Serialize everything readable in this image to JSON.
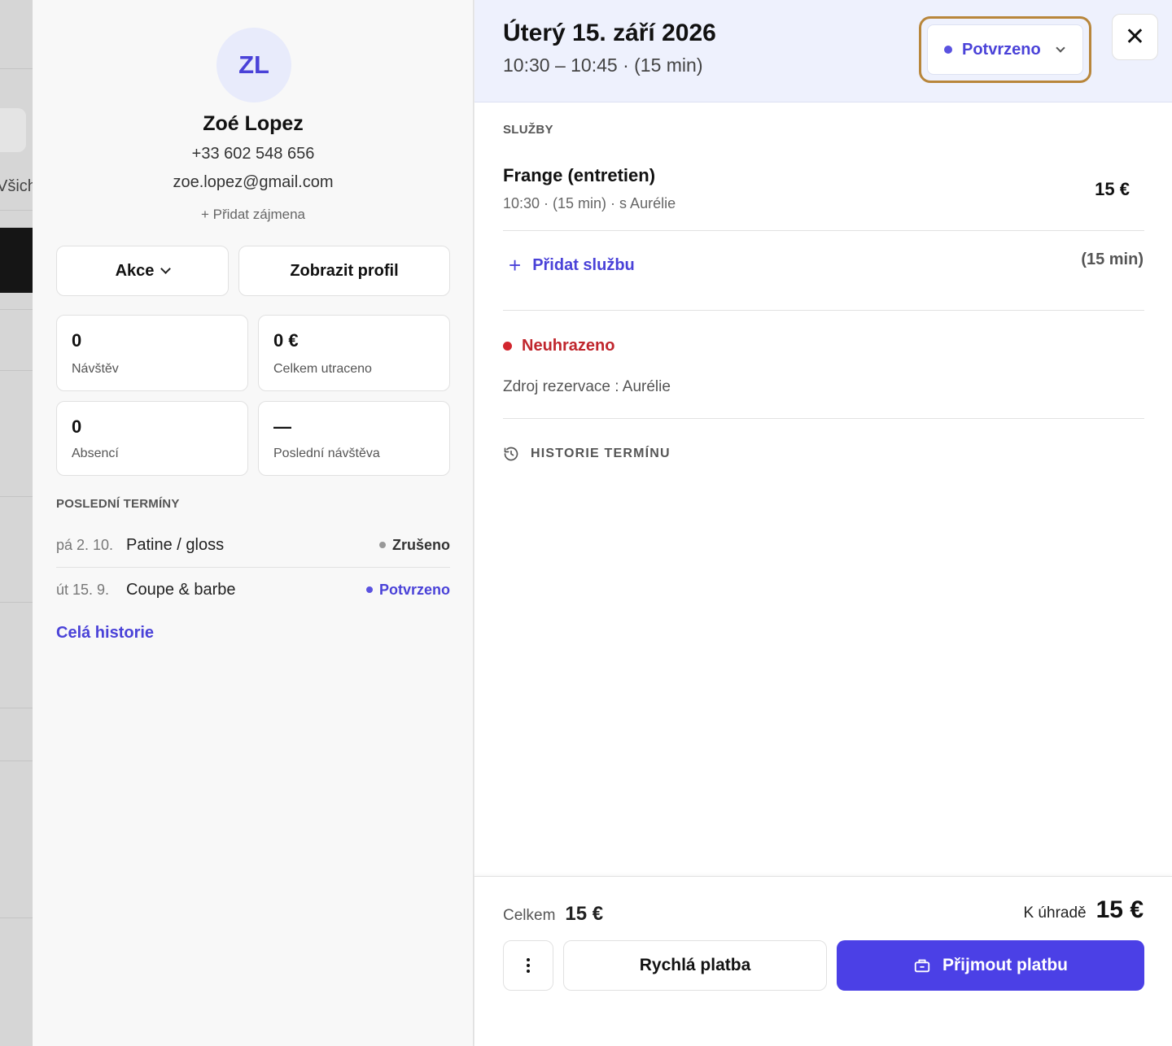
{
  "background": {
    "partial_text": "Všich"
  },
  "client": {
    "initials": "ZL",
    "name": "Zoé Lopez",
    "phone": "+33 602 548 656",
    "email": "zoe.lopez@gmail.com",
    "add_pronouns": "+ Přidat zájmena",
    "actions_label": "Akce",
    "view_profile_label": "Zobrazit profil",
    "stats": [
      {
        "value": "0",
        "label": "Návštěv"
      },
      {
        "value": "0 €",
        "label": "Celkem utraceno"
      },
      {
        "value": "0",
        "label": "Absencí"
      },
      {
        "value": "—",
        "label": "Poslední návštěva"
      }
    ],
    "recent_title": "POSLEDNÍ TERMÍNY",
    "recent": [
      {
        "date": "pá 2. 10.",
        "service": "Patine / gloss",
        "status": "Zrušeno",
        "status_color": "#333333",
        "dot_color": "#999999"
      },
      {
        "date": "út 15. 9.",
        "service": "Coupe & barbe",
        "status": "Potvrzeno",
        "status_color": "#4a42d8",
        "dot_color": "#5a52e0"
      }
    ],
    "history_link": "Celá historie"
  },
  "appointment": {
    "date": "Úterý 15. září 2026",
    "time": "10:30 – 10:45 · (15 min)",
    "status": "Potvrzeno",
    "close_icon": "close-icon",
    "services_title": "SLUŽBY",
    "service": {
      "name": "Frange (entretien)",
      "meta": "10:30 · (15 min) · s Aurélie",
      "price": "15 €"
    },
    "add_service": "Přidat službu",
    "add_duration": "(15 min)",
    "payment_status": "Neuhrazeno",
    "source": "Zdroj rezervace : Aurélie",
    "history_title": "HISTORIE TERMÍNU"
  },
  "footer": {
    "total_label": "Celkem",
    "total_amount": "15 €",
    "due_label": "K úhradě",
    "due_amount": "15 €",
    "quick_pay": "Rychlá platba",
    "accept_pay": "Přijmout platbu"
  },
  "colors": {
    "accent": "#4a42d8",
    "primary_button": "#4b40e6",
    "unpaid": "#c0262d",
    "focus_ring": "#b8863b",
    "header_bg": "#eef1fd"
  }
}
